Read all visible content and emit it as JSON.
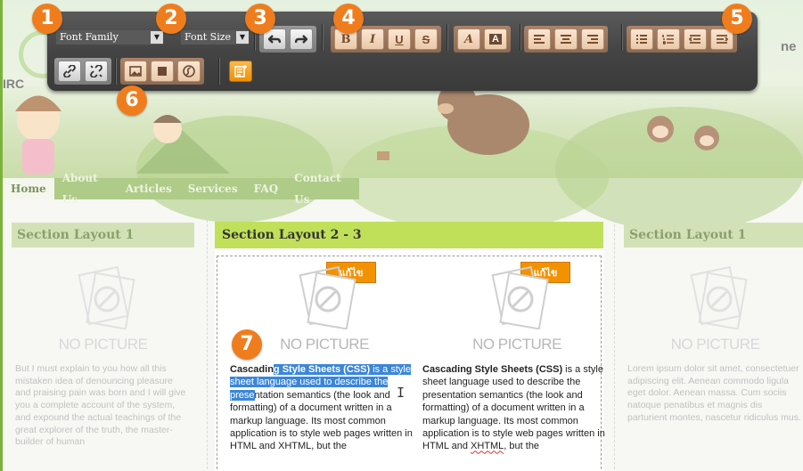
{
  "header": {
    "brand_suffix": "ne",
    "brand_prefix": "IRC"
  },
  "nav": {
    "items": [
      "Home",
      "About Us",
      "Articles",
      "Services",
      "FAQ",
      "Contact Us"
    ]
  },
  "toolbar": {
    "font_family": "Font Family",
    "font_size": "Font Size",
    "undo_icon": "undo-icon",
    "redo_icon": "redo-icon",
    "bold": "B",
    "italic": "I",
    "underline": "U",
    "strike": "S",
    "highlight": "A",
    "text_color": "A",
    "link_icon": "link-icon",
    "unlink_icon": "unlink-icon",
    "image_icon": "image-icon",
    "media_icon": "media-icon",
    "flash_icon": "flash-icon",
    "template_icon": "insert-template-icon"
  },
  "markers": [
    "1",
    "2",
    "3",
    "4",
    "5",
    "6",
    "7"
  ],
  "columns": {
    "left": {
      "title": "Section Layout 1",
      "nopic": "NO PICTURE",
      "text": "But I must explain to you how all this mistaken idea of denouncing pleasure and praising pain was born and I will give you a complete account of the system, and expound the actual teachings of the great explorer of the truth, the master-builder of human"
    },
    "center": {
      "title": "Section Layout 2 - 3",
      "edit_a": "แก้ไข",
      "edit_b": "แก้ไข",
      "nopic_a": "NO PICTURE",
      "nopic_b": "NO PICTURE",
      "text_a": {
        "bold_1": "Cascadin",
        "hl_bold": "g Style Sheets (CSS)",
        "hl_rest": " is a style sheet language used to describe the prese",
        "rest": "ntation semantics (the look and formatting) of a document written in a markup language. Its most common application is to style web pages written in HTML and XHTML, but the"
      },
      "text_b": {
        "bold": "Cascading Style Sheets (CSS)",
        "rest_1": " is a style sheet language used to describe the presentation semantics (the look and formatting) of a document written in a markup language. Its most common application is to style web pages written in HTML and ",
        "xhtml": "XHTML",
        "rest_2": ", but the"
      }
    },
    "right": {
      "title": "Section Layout 1",
      "nopic": "NO PICTURE",
      "text": "Lorem ipsum dolor sit amet, consectetuer adipiscing elit. Aenean commodo ligula eget dolor. Aenean massa. Cum sociis natoque penatibus et magnis dis parturient montes, nascetur ridiculus mus."
    }
  }
}
